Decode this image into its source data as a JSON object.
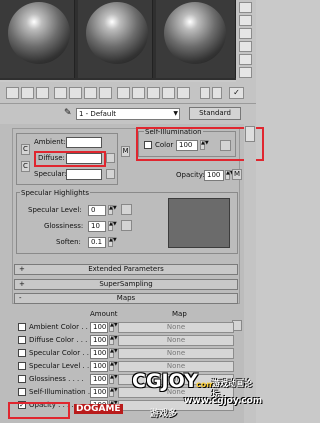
{
  "toolbar_right": {
    "icon": "checkmark-icon"
  },
  "material": {
    "name": "1 - Default",
    "type_button": "Standard"
  },
  "basic": {
    "ambient_label": "Ambient:",
    "diffuse_label": "Diffuse:",
    "specular_label": "Specular:",
    "lock_c": "C",
    "lock_c2": "C",
    "map_btn": "M",
    "self_illum_title": "Self-Illumination",
    "color_label": "Color",
    "color_value": "100",
    "opacity_label": "Opacity:",
    "opacity_value": "100",
    "opacity_map": "M"
  },
  "specular": {
    "title": "Specular Highlights",
    "level_label": "Specular Level:",
    "level_value": "0",
    "gloss_label": "Glossiness:",
    "gloss_value": "10",
    "soften_label": "Soften:",
    "soften_value": "0.1"
  },
  "rollouts": {
    "extended": "Extended Parameters",
    "supersampling": "SuperSampling",
    "maps": "Maps",
    "plus": "+",
    "minus": "-"
  },
  "maps": {
    "amount_header": "Amount",
    "map_header": "Map",
    "rows": [
      {
        "label": "Ambient Color . . .",
        "amount": "100",
        "map": "None",
        "checked": ""
      },
      {
        "label": "Diffuse Color . . .",
        "amount": "100",
        "map": "None",
        "checked": ""
      },
      {
        "label": "Specular Color . .",
        "amount": "100",
        "map": "None",
        "checked": ""
      },
      {
        "label": "Specular Level . .",
        "amount": "100",
        "map": "None",
        "checked": ""
      },
      {
        "label": "Glossiness . . . .",
        "amount": "100",
        "map": "None",
        "checked": ""
      },
      {
        "label": "Self-Illumination .",
        "amount": "100",
        "map": "None",
        "checked": ""
      },
      {
        "label": "Opacity . . . . . .",
        "amount": "100",
        "map": "",
        "checked": "✓"
      }
    ]
  },
  "watermark": {
    "logo": "CGJOY",
    "site": "com",
    "slogan": "游戏动画论坛",
    "url": "www.cgjoy.com",
    "bottom": "DOGAME",
    "bottom_cn": "游戏多"
  }
}
